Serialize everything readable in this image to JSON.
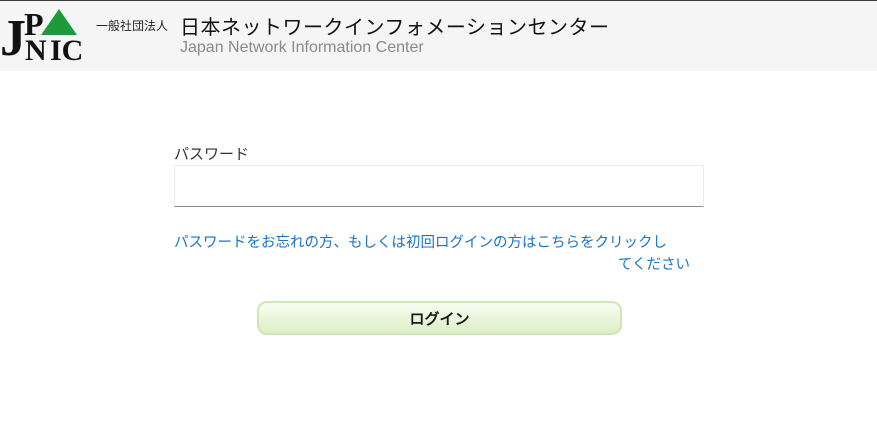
{
  "header": {
    "logo": {
      "text_j": "J",
      "text_p": "P",
      "text_n": "N",
      "text_ic": "IC",
      "triangle_color": "#1e9a3c",
      "text_color": "#111111"
    },
    "org_type": "一般社団法人",
    "org_name": "日本ネットワークインフォメーションセンター",
    "org_name_en": "Japan Network Information Center"
  },
  "form": {
    "password_label": "パスワード",
    "password_value": "",
    "password_placeholder": "",
    "forgot_link_line1": "パスワードをお忘れの方、もしくは初回ログインの方はこちらをクリックし",
    "forgot_link_line2": "てください",
    "login_button": "ログイン"
  },
  "colors": {
    "header_bg": "#f5f5f5",
    "link": "#1a73c7",
    "button_border": "#cfe6b6",
    "button_bg_top": "#f7fcf1",
    "button_bg_bottom": "#dcefc7"
  }
}
